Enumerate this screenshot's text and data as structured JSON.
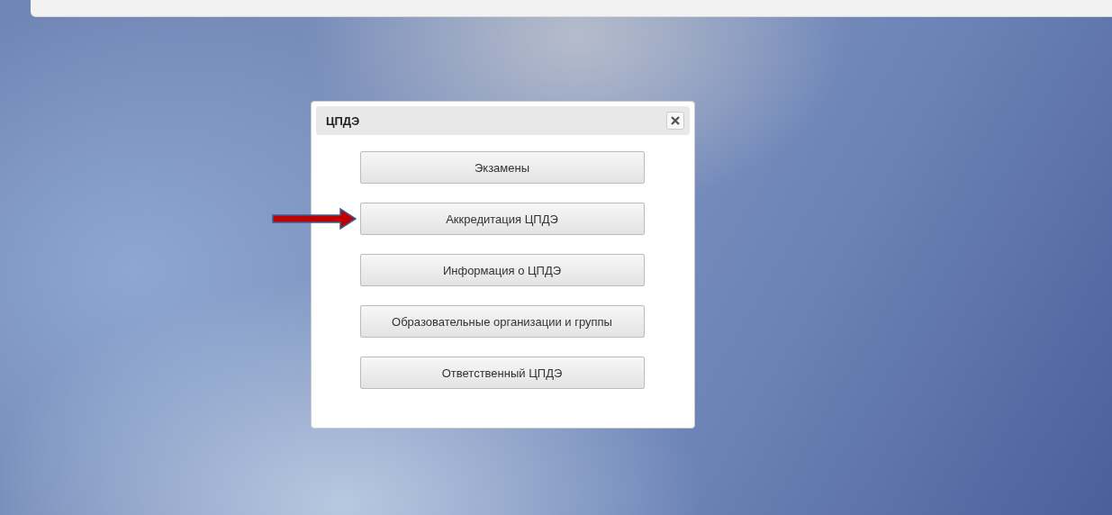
{
  "dialog": {
    "title": "ЦПДЭ",
    "buttons": [
      {
        "label": "Экзамены",
        "arrow": false
      },
      {
        "label": "Аккредитация ЦПДЭ",
        "arrow": true
      },
      {
        "label": "Информация о ЦПДЭ",
        "arrow": false
      },
      {
        "label": "Образовательные организации и группы",
        "arrow": false
      },
      {
        "label": "Ответственный ЦПДЭ",
        "arrow": false
      }
    ]
  }
}
